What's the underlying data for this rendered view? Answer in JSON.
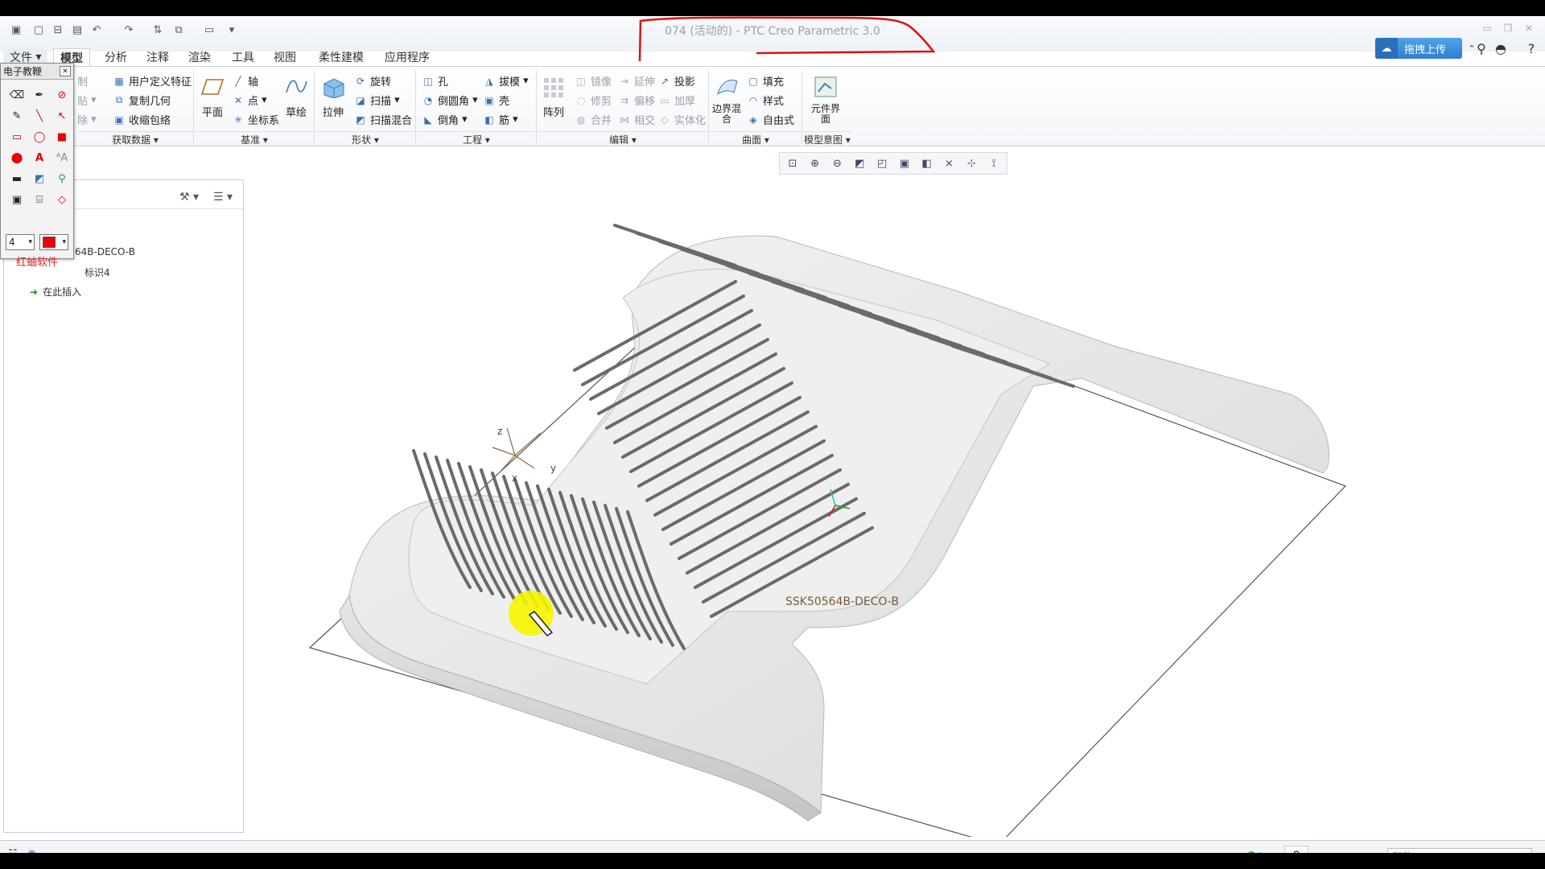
{
  "window": {
    "title": "074 (活动的) - PTC Creo Parametric 3.0",
    "upload_label": "拖拽上传"
  },
  "tabs": [
    {
      "label": "文件",
      "id": "file"
    },
    {
      "label": "模型",
      "id": "model"
    },
    {
      "label": "分析",
      "id": "analysis"
    },
    {
      "label": "注释",
      "id": "annotate"
    },
    {
      "label": "渲染",
      "id": "render"
    },
    {
      "label": "工具",
      "id": "tools"
    },
    {
      "label": "视图",
      "id": "view"
    },
    {
      "label": "柔性建模",
      "id": "flexible"
    },
    {
      "label": "应用程序",
      "id": "apps"
    }
  ],
  "ribbon": {
    "get_data": {
      "copy": "制",
      "paste": "贴",
      "delete": "除",
      "udf": "用户定义特征",
      "copy_geom": "复制几何",
      "shrinkwrap": "收缩包络",
      "group": "获取数据"
    },
    "datum": {
      "plane": "平面",
      "axis": "轴",
      "point": "点",
      "csys": "坐标系",
      "sketch": "草绘",
      "group": "基准"
    },
    "shapes": {
      "extrude": "拉伸",
      "revolve": "旋转",
      "sweep": "扫描",
      "swept_blend": "扫描混合",
      "group": "形状"
    },
    "engineering": {
      "hole": "孔",
      "round": "倒圆角",
      "chamfer": "倒角",
      "draft": "拔模",
      "shell": "壳",
      "rib": "筋",
      "group": "工程"
    },
    "editing": {
      "pattern": "阵列",
      "mirror": "镜像",
      "trim": "修剪",
      "merge": "合并",
      "extend": "延伸",
      "offset": "偏移",
      "intersect": "相交",
      "project": "投影",
      "thicken": "加厚",
      "solidify": "实体化",
      "group": "编辑"
    },
    "surfaces": {
      "boundary_blend": "边界混合",
      "fill": "填充",
      "style": "样式",
      "freestyle": "自由式",
      "group": "曲面"
    },
    "model_intent": {
      "component_interface": "元件界面",
      "group": "模型意图"
    }
  },
  "palette": {
    "title": "电子教鞭",
    "size_value": "4",
    "brand": "红蚰软件"
  },
  "model_tree": {
    "part_name": "64B-DECO-B",
    "mark_item": "标识4",
    "insert_here": "在此插入"
  },
  "viewport": {
    "csys_label": "SSK50564B-DECO-B",
    "axis_x": "x",
    "axis_y": "y",
    "axis_z": "z"
  },
  "status": {
    "filter": "智能"
  },
  "colors": {
    "accent_blue": "#2f7fcf",
    "annotation_red": "#e01010",
    "highlight_yellow": "#f5f500"
  }
}
